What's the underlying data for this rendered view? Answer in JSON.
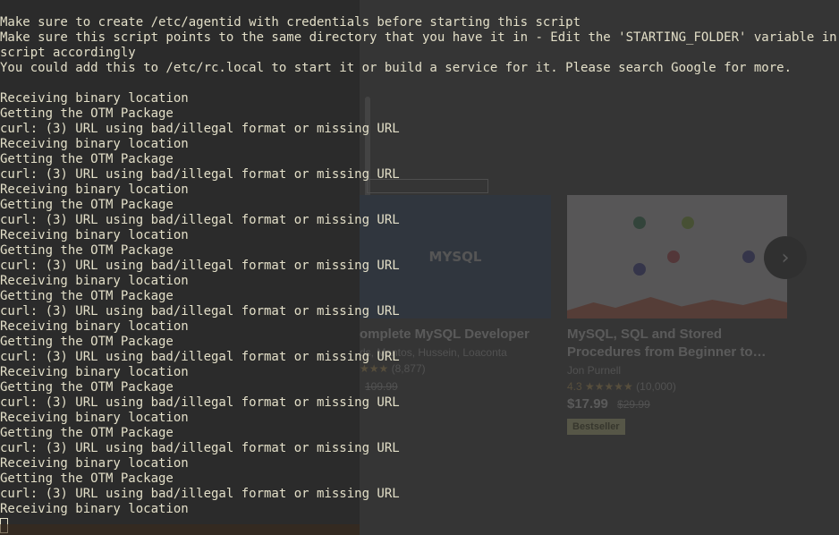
{
  "terminal": {
    "lines": [
      "Make sure to create /etc/agentid with credentials before starting this script",
      "Make sure this script points to the same directory that you have it in - Edit the 'STARTING_FOLDER' variable in this",
      "script accordingly",
      "You could add this to /etc/rc.local to start it or build a service for it. Please search Google for more.",
      "",
      "Receiving binary location",
      "Getting the OTM Package",
      "curl: (3) URL using bad/illegal format or missing URL",
      "Receiving binary location",
      "Getting the OTM Package",
      "curl: (3) URL using bad/illegal format or missing URL",
      "Receiving binary location",
      "Getting the OTM Package",
      "curl: (3) URL using bad/illegal format or missing URL",
      "Receiving binary location",
      "Getting the OTM Package",
      "curl: (3) URL using bad/illegal format or missing URL",
      "Receiving binary location",
      "Getting the OTM Package",
      "curl: (3) URL using bad/illegal format or missing URL",
      "Receiving binary location",
      "Getting the OTM Package",
      "curl: (3) URL using bad/illegal format or missing URL",
      "Receiving binary location",
      "Getting the OTM Package",
      "curl: (3) URL using bad/illegal format or missing URL",
      "Receiving binary location",
      "Getting the OTM Package",
      "curl: (3) URL using bad/illegal format or missing URL",
      "Receiving binary location",
      "Getting the OTM Package",
      "curl: (3) URL using bad/illegal format or missing URL",
      "Receiving binary location"
    ],
    "text_color": "#e3dfc8"
  },
  "background_page": {
    "cards": [
      {
        "thumb_text": "MYSQL",
        "title": "omplete MySQL Developer",
        "author": "ds, Mantos, Hussein, Loaconta",
        "rating": "★★★",
        "rating_count": "(8,877)",
        "old_price": "109.99"
      },
      {
        "title": "MySQL, SQL and Stored Procedures from Beginner to…",
        "author": "Jon Purnell",
        "rating": "4.3 ★★★★★",
        "rating_count": "(10,000)",
        "price": "$17.99",
        "old_price": "$29.99",
        "badge": "Bestseller"
      }
    ],
    "next_icon": "chevron-right-icon"
  }
}
